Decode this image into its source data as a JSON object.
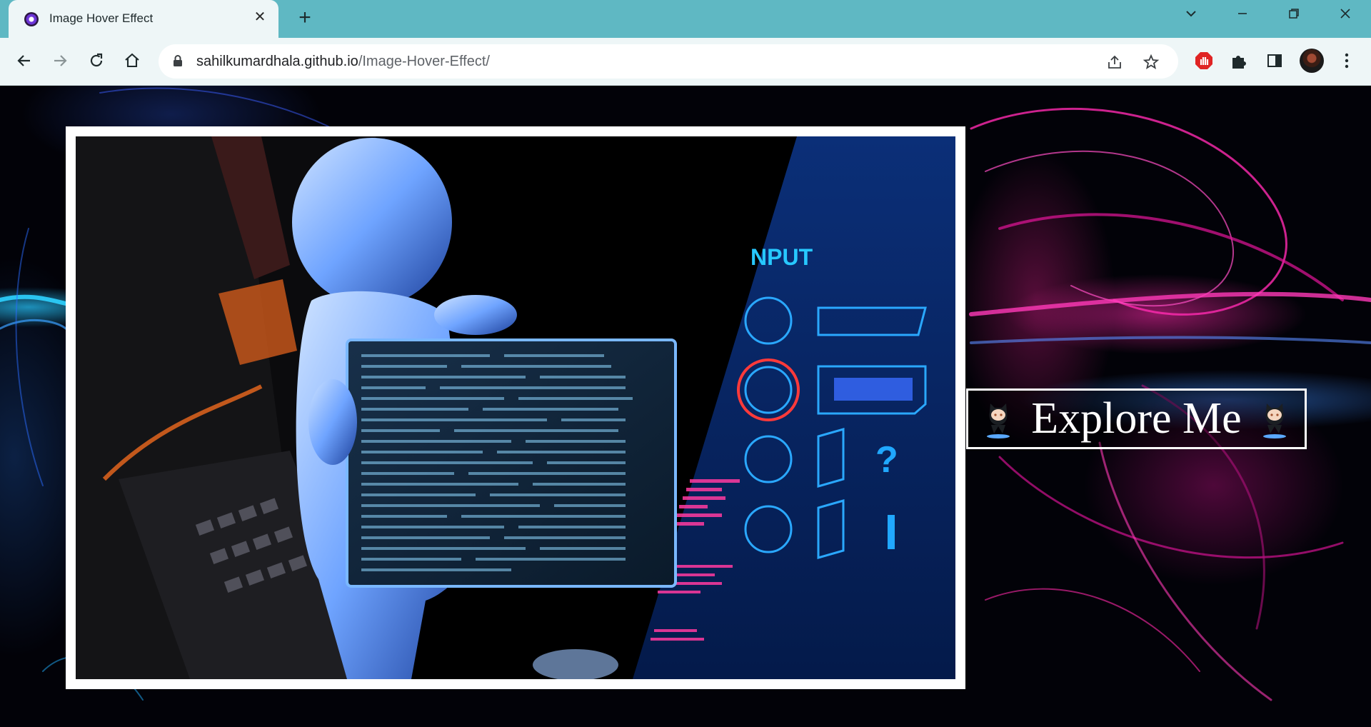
{
  "browser": {
    "tab": {
      "title": "Image Hover Effect",
      "close_glyph": "✕",
      "favicon": "app-favicon-icon"
    },
    "new_tab_glyph": "+",
    "window_controls": {
      "dropdown": "⌄",
      "minimize": "—",
      "restore": "❐",
      "close": "✕"
    },
    "address_bar": {
      "host": "sahilkumardhala.github.io",
      "path": "/Image-Hover-Effect/"
    },
    "extensions": [
      "adblock-icon",
      "puzzle-extensions-icon",
      "side-panel-icon",
      "profile-avatar",
      "kebab-menu-icon"
    ]
  },
  "page": {
    "image": {
      "description_icon": "humanoid-with-code-screen-image",
      "overlay_text": "NPUT"
    },
    "button": {
      "label": "Explore Me",
      "left_icon": "octocat-icon",
      "right_icon": "octocat-icon"
    }
  },
  "colors": {
    "tab_strip": "#5fb8c3",
    "toolbar": "#eef6f7",
    "accent_magenta": "#ff2aa8",
    "accent_cyan": "#28c8ff"
  }
}
